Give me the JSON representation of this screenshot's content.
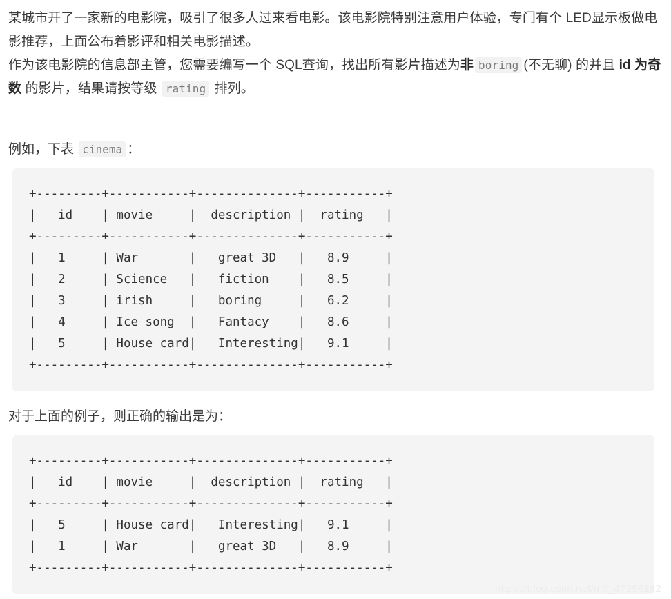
{
  "document": {
    "intro": {
      "paragraph_1": "某城市开了一家新的电影院，吸引了很多人过来看电影。该电影院特别注意用户体验，专门有个 LED显示板做电影推荐，上面公布着影评和相关电影描述。",
      "paragraph_2": {
        "segment_1": "作为该电影院的信息部主管，您需要编写一个 SQL查询，找出所有影片描述为",
        "bold_1": "非",
        "code_1": "boring",
        "segment_2": "(不无聊) 的并且 ",
        "bold_2": "id 为奇数",
        "segment_3": " 的影片，结果请按等级 ",
        "code_2": "rating",
        "segment_4": " 排列。"
      }
    },
    "example_section": {
      "lead_in_prefix": "例如，下表 ",
      "lead_in_code": "cinema",
      "lead_in_suffix": "：",
      "table_text": "+---------+-----------+--------------+-----------+\n|   id    | movie     |  description |  rating   |\n+---------+-----------+--------------+-----------+\n|   1     | War       |   great 3D   |   8.9     |\n|   2     | Science   |   fiction    |   8.5     |\n|   3     | irish     |   boring     |   6.2     |\n|   4     | Ice song  |   Fantacy    |   8.6     |\n|   5     | House card|   Interesting|   9.1     |\n+---------+-----------+--------------+-----------+",
      "table_data": {
        "columns": [
          "id",
          "movie",
          "description",
          "rating"
        ],
        "rows": [
          [
            "1",
            "War",
            "great 3D",
            "8.9"
          ],
          [
            "2",
            "Science",
            "fiction",
            "8.5"
          ],
          [
            "3",
            "irish",
            "boring",
            "6.2"
          ],
          [
            "4",
            "Ice song",
            "Fantacy",
            "8.6"
          ],
          [
            "5",
            "House card",
            "Interesting",
            "9.1"
          ]
        ]
      }
    },
    "output_section": {
      "lead_in": "对于上面的例子，则正确的输出是为：",
      "table_text": "+---------+-----------+--------------+-----------+\n|   id    | movie     |  description |  rating   |\n+---------+-----------+--------------+-----------+\n|   5     | House card|   Interesting|   9.1     |\n|   1     | War       |   great 3D   |   8.9     |\n+---------+-----------+--------------+-----------+",
      "table_data": {
        "columns": [
          "id",
          "movie",
          "description",
          "rating"
        ],
        "rows": [
          [
            "5",
            "House card",
            "Interesting",
            "9.1"
          ],
          [
            "1",
            "War",
            "great 3D",
            "8.9"
          ]
        ]
      }
    },
    "watermark": "https://blog.csdn.net/m0_47256162"
  }
}
